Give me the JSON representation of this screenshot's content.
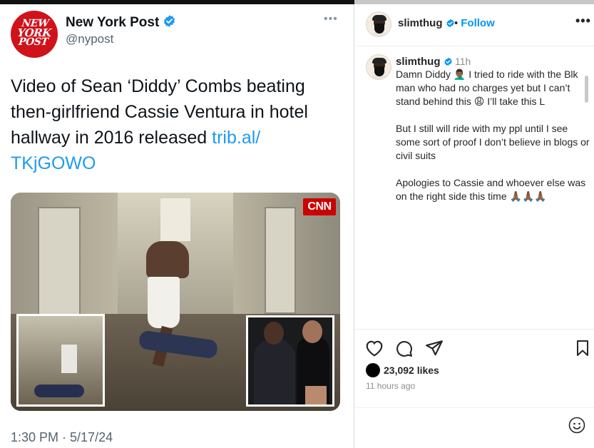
{
  "tweet": {
    "account_name": "New York Post",
    "handle": "@nypost",
    "logo_text": [
      "NEW",
      "YORK",
      "POST"
    ],
    "text": "Video of Sean ‘Diddy’ Combs beating then-girlfriend Cassie Ventura in hotel hallway in 2016 released ",
    "link": "trib.al/TKjGOWO",
    "link_line1": "trib.al/",
    "link_line2": "TKjGOWO",
    "media_badge": "CNN",
    "timestamp": "1:30 PM · 5/17/24",
    "verified": true
  },
  "instagram": {
    "username": "slimthug",
    "verified": true,
    "follow_label": "Follow",
    "time_ago": "11h",
    "caption": [
      "Damn Diddy 🤦🏾‍♂️ I tried to ride with the Blk man who had no charges yet but I can’t stand behind this 😩 I’ll take this L",
      "But I still will ride with my ppl until I see some sort of proof I don’t believe in blogs or civil suits",
      "Apologies to Cassie and whoever else was on the right side this time 🙏🏾🙏🏾🙏🏾"
    ],
    "likes": "23,092 likes",
    "posted": "11 hours ago"
  },
  "colors": {
    "twitter_blue": "#1d9bf0",
    "nyp_red": "#d0121b",
    "ig_blue": "#0095f6"
  },
  "icons": [
    "verified-badge-icon",
    "more-dots-icon",
    "heart-icon",
    "comment-icon",
    "share-icon",
    "bookmark-icon",
    "emoji-icon"
  ]
}
